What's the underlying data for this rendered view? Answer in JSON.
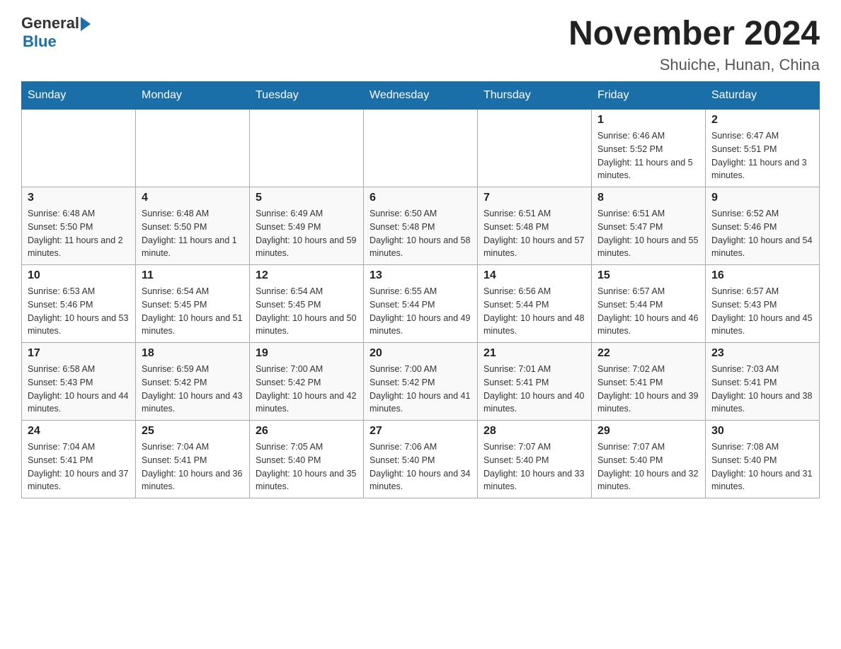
{
  "header": {
    "logo_general": "General",
    "logo_blue": "Blue",
    "month_title": "November 2024",
    "location": "Shuiche, Hunan, China"
  },
  "weekdays": [
    "Sunday",
    "Monday",
    "Tuesday",
    "Wednesday",
    "Thursday",
    "Friday",
    "Saturday"
  ],
  "weeks": [
    [
      {
        "day": "",
        "info": ""
      },
      {
        "day": "",
        "info": ""
      },
      {
        "day": "",
        "info": ""
      },
      {
        "day": "",
        "info": ""
      },
      {
        "day": "",
        "info": ""
      },
      {
        "day": "1",
        "info": "Sunrise: 6:46 AM\nSunset: 5:52 PM\nDaylight: 11 hours and 5 minutes."
      },
      {
        "day": "2",
        "info": "Sunrise: 6:47 AM\nSunset: 5:51 PM\nDaylight: 11 hours and 3 minutes."
      }
    ],
    [
      {
        "day": "3",
        "info": "Sunrise: 6:48 AM\nSunset: 5:50 PM\nDaylight: 11 hours and 2 minutes."
      },
      {
        "day": "4",
        "info": "Sunrise: 6:48 AM\nSunset: 5:50 PM\nDaylight: 11 hours and 1 minute."
      },
      {
        "day": "5",
        "info": "Sunrise: 6:49 AM\nSunset: 5:49 PM\nDaylight: 10 hours and 59 minutes."
      },
      {
        "day": "6",
        "info": "Sunrise: 6:50 AM\nSunset: 5:48 PM\nDaylight: 10 hours and 58 minutes."
      },
      {
        "day": "7",
        "info": "Sunrise: 6:51 AM\nSunset: 5:48 PM\nDaylight: 10 hours and 57 minutes."
      },
      {
        "day": "8",
        "info": "Sunrise: 6:51 AM\nSunset: 5:47 PM\nDaylight: 10 hours and 55 minutes."
      },
      {
        "day": "9",
        "info": "Sunrise: 6:52 AM\nSunset: 5:46 PM\nDaylight: 10 hours and 54 minutes."
      }
    ],
    [
      {
        "day": "10",
        "info": "Sunrise: 6:53 AM\nSunset: 5:46 PM\nDaylight: 10 hours and 53 minutes."
      },
      {
        "day": "11",
        "info": "Sunrise: 6:54 AM\nSunset: 5:45 PM\nDaylight: 10 hours and 51 minutes."
      },
      {
        "day": "12",
        "info": "Sunrise: 6:54 AM\nSunset: 5:45 PM\nDaylight: 10 hours and 50 minutes."
      },
      {
        "day": "13",
        "info": "Sunrise: 6:55 AM\nSunset: 5:44 PM\nDaylight: 10 hours and 49 minutes."
      },
      {
        "day": "14",
        "info": "Sunrise: 6:56 AM\nSunset: 5:44 PM\nDaylight: 10 hours and 48 minutes."
      },
      {
        "day": "15",
        "info": "Sunrise: 6:57 AM\nSunset: 5:44 PM\nDaylight: 10 hours and 46 minutes."
      },
      {
        "day": "16",
        "info": "Sunrise: 6:57 AM\nSunset: 5:43 PM\nDaylight: 10 hours and 45 minutes."
      }
    ],
    [
      {
        "day": "17",
        "info": "Sunrise: 6:58 AM\nSunset: 5:43 PM\nDaylight: 10 hours and 44 minutes."
      },
      {
        "day": "18",
        "info": "Sunrise: 6:59 AM\nSunset: 5:42 PM\nDaylight: 10 hours and 43 minutes."
      },
      {
        "day": "19",
        "info": "Sunrise: 7:00 AM\nSunset: 5:42 PM\nDaylight: 10 hours and 42 minutes."
      },
      {
        "day": "20",
        "info": "Sunrise: 7:00 AM\nSunset: 5:42 PM\nDaylight: 10 hours and 41 minutes."
      },
      {
        "day": "21",
        "info": "Sunrise: 7:01 AM\nSunset: 5:41 PM\nDaylight: 10 hours and 40 minutes."
      },
      {
        "day": "22",
        "info": "Sunrise: 7:02 AM\nSunset: 5:41 PM\nDaylight: 10 hours and 39 minutes."
      },
      {
        "day": "23",
        "info": "Sunrise: 7:03 AM\nSunset: 5:41 PM\nDaylight: 10 hours and 38 minutes."
      }
    ],
    [
      {
        "day": "24",
        "info": "Sunrise: 7:04 AM\nSunset: 5:41 PM\nDaylight: 10 hours and 37 minutes."
      },
      {
        "day": "25",
        "info": "Sunrise: 7:04 AM\nSunset: 5:41 PM\nDaylight: 10 hours and 36 minutes."
      },
      {
        "day": "26",
        "info": "Sunrise: 7:05 AM\nSunset: 5:40 PM\nDaylight: 10 hours and 35 minutes."
      },
      {
        "day": "27",
        "info": "Sunrise: 7:06 AM\nSunset: 5:40 PM\nDaylight: 10 hours and 34 minutes."
      },
      {
        "day": "28",
        "info": "Sunrise: 7:07 AM\nSunset: 5:40 PM\nDaylight: 10 hours and 33 minutes."
      },
      {
        "day": "29",
        "info": "Sunrise: 7:07 AM\nSunset: 5:40 PM\nDaylight: 10 hours and 32 minutes."
      },
      {
        "day": "30",
        "info": "Sunrise: 7:08 AM\nSunset: 5:40 PM\nDaylight: 10 hours and 31 minutes."
      }
    ]
  ]
}
